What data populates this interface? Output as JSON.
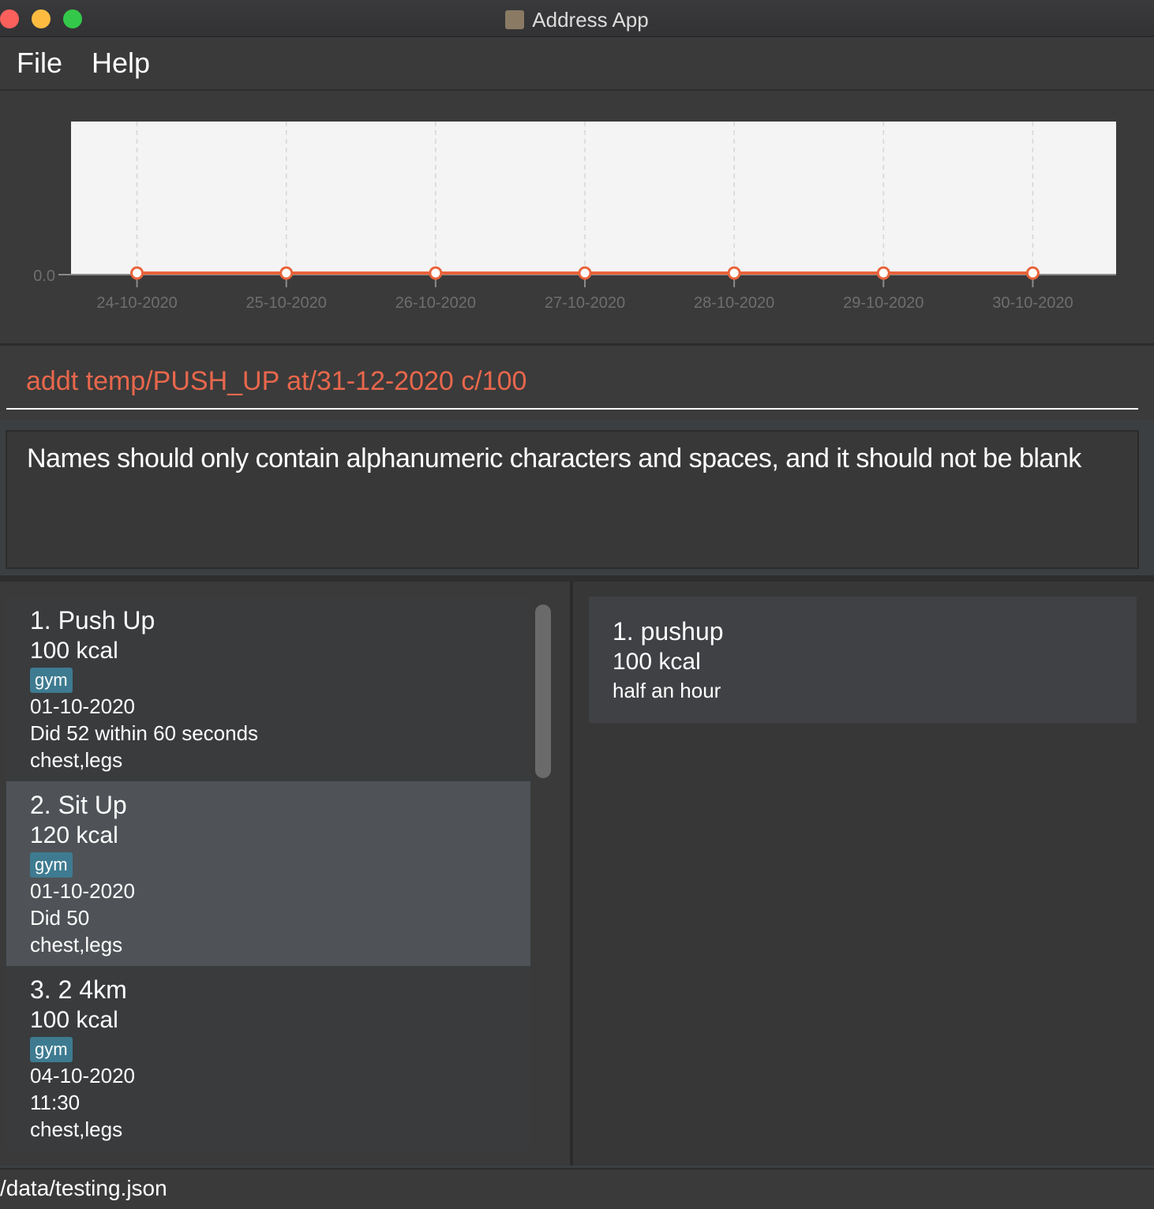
{
  "window": {
    "title": "Address App"
  },
  "menu": {
    "file": "File",
    "help": "Help"
  },
  "chart_data": {
    "type": "line",
    "categories": [
      "24-10-2020",
      "25-10-2020",
      "26-10-2020",
      "27-10-2020",
      "28-10-2020",
      "29-10-2020",
      "30-10-2020"
    ],
    "values": [
      0,
      0,
      0,
      0,
      0,
      0,
      0
    ],
    "y_tick_labels": [
      "0.0"
    ],
    "ylim": [
      0,
      1
    ],
    "grid": true,
    "colors": {
      "line": "#e8633a",
      "plot_bg": "#f4f4f4",
      "tick_label": "#6e6e6e"
    }
  },
  "command": {
    "text": "addt temp/PUSH_UP at/31-12-2020 c/100"
  },
  "result": {
    "text": "Names should only contain alphanumeric characters and spaces, and it should not be blank"
  },
  "exercises": [
    {
      "title": "1.  Push Up",
      "kcal": "100  kcal",
      "tag": "gym",
      "date": "01-10-2020",
      "desc": "Did 52 within 60 seconds",
      "muscles": "chest,legs"
    },
    {
      "title": "2.  Sit Up",
      "kcal": "120  kcal",
      "tag": "gym",
      "date": "01-10-2020",
      "desc": "Did 50",
      "muscles": "chest,legs"
    },
    {
      "title": "3.  2 4km",
      "kcal": "100  kcal",
      "tag": "gym",
      "date": "04-10-2020",
      "desc": "11:30",
      "muscles": "chest,legs"
    }
  ],
  "templates": [
    {
      "title": "1.  pushup",
      "kcal": "100  kcal",
      "duration": "half an hour"
    }
  ],
  "status": {
    "path": "/data/testing.json"
  }
}
